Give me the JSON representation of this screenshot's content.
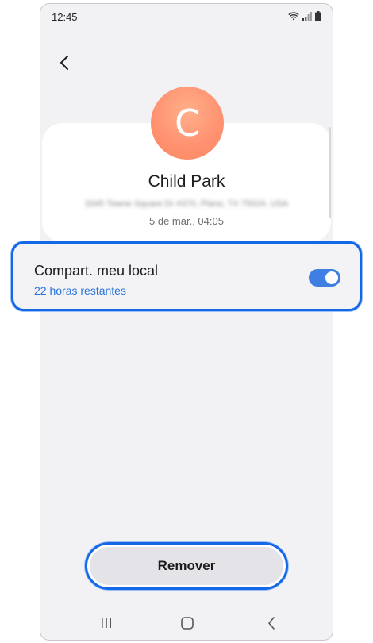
{
  "status_bar": {
    "time": "12:45"
  },
  "contact": {
    "avatar_letter": "C",
    "name": "Child Park",
    "address": "3345 Towne Square Dr #370, Plano, TX 75024, USA",
    "date": "5 de mar., 04:05"
  },
  "share_location": {
    "label": "Compart. meu local",
    "remaining": "22 horas restantes",
    "enabled": true
  },
  "actions": {
    "remove_label": "Remover"
  },
  "colors": {
    "accent": "#3f7fe3",
    "highlight": "#1468e8",
    "avatar": "#ff9070",
    "subtext_blue": "#2a72d8"
  },
  "icons": {
    "back": "chevron-left-icon",
    "nav_recents": "recents-icon",
    "nav_home": "home-icon",
    "nav_back": "back-icon"
  }
}
